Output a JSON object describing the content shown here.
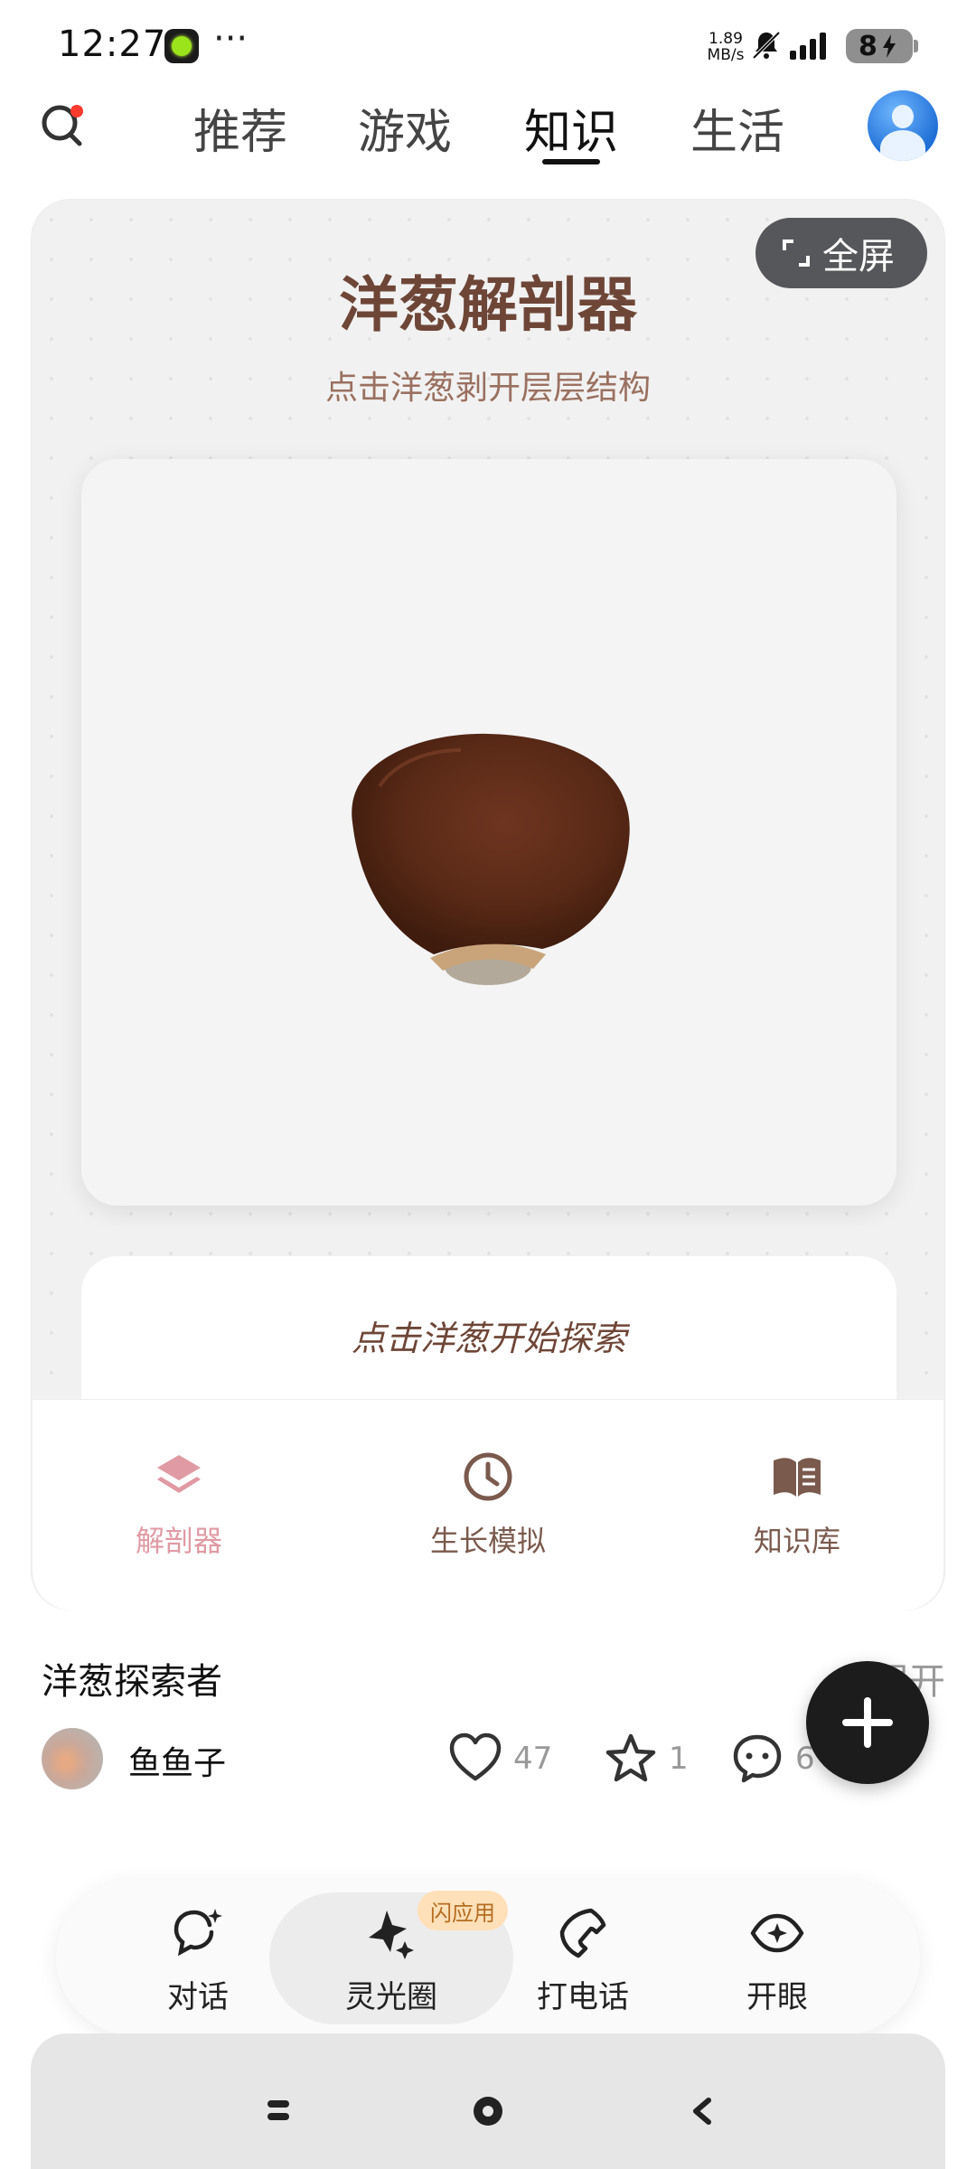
{
  "status_bar": {
    "time": "12:27",
    "more": "···",
    "net_speed_value": "1.89",
    "net_speed_unit": "MB/s",
    "battery": "8"
  },
  "top_tabs": {
    "tabs": [
      "推荐",
      "游戏",
      "知识",
      "生活"
    ],
    "active": "知识"
  },
  "app_card": {
    "fullscreen_label": "全屏",
    "title": "洋葱解剖器",
    "subtitle": "点击洋葱剥开层层结构",
    "hint": "点击洋葱开始探索",
    "bottom_nav": [
      {
        "label": "解剖器",
        "icon": "layers-icon",
        "active": true
      },
      {
        "label": "生长模拟",
        "icon": "clock-icon",
        "active": false
      },
      {
        "label": "知识库",
        "icon": "book-icon",
        "active": false
      }
    ]
  },
  "post": {
    "title": "洋葱探索者",
    "expand": "展开",
    "author": "鱼鱼子",
    "likes": "47",
    "favorites": "1",
    "comments": "6"
  },
  "dock": {
    "items": [
      "对话",
      "灵光圈",
      "打电话",
      "开眼"
    ],
    "active": "灵光圈",
    "badge": "闪应用"
  },
  "colors": {
    "title_brown": "#6e4637",
    "active_pink": "#e09aa4",
    "onion_brown": "#5a2a17"
  }
}
